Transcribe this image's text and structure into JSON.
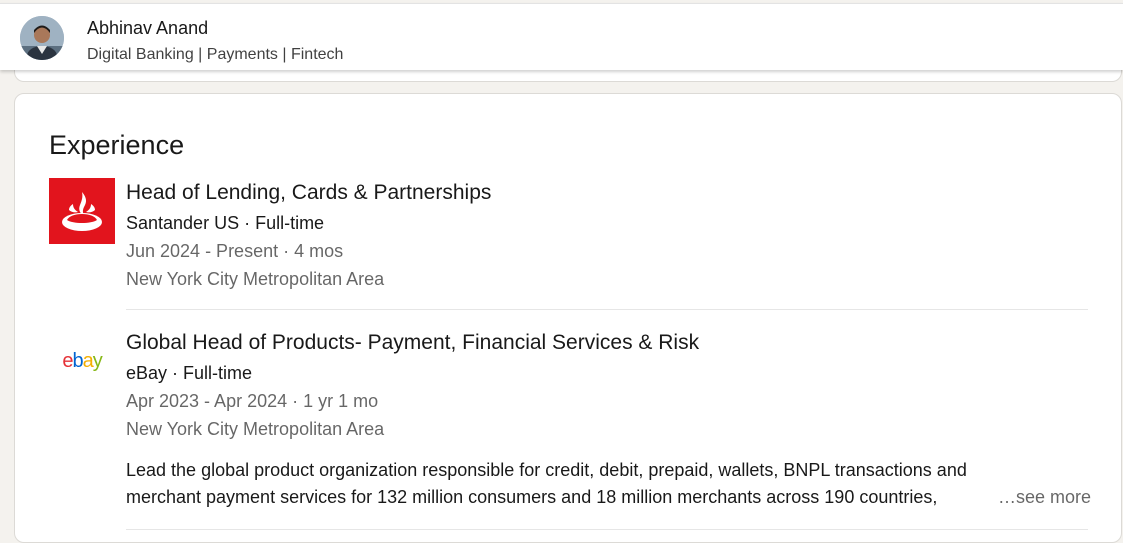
{
  "profile": {
    "name": "Abhinav Anand",
    "headline": "Digital Banking | Payments | Fintech"
  },
  "experience": {
    "title": "Experience",
    "entries": [
      {
        "title": "Head of Lending, Cards & Partnerships",
        "company": "Santander US · Full-time",
        "dates": "Jun 2024 - Present · 4 mos",
        "location": "New York City Metropolitan Area",
        "logo": "santander-flame-logo",
        "logo_color": "#e2141d"
      },
      {
        "title": "Global Head of Products- Payment, Financial Services & Risk",
        "company": "eBay · Full-time",
        "dates": "Apr 2023 - Apr 2024 · 1 yr 1 mo",
        "location": "New York City Metropolitan Area",
        "logo": "ebay-logo",
        "logo_letters": [
          "e",
          "b",
          "a",
          "y"
        ],
        "logo_colors": [
          "#e53238",
          "#0064d2",
          "#f5af02",
          "#86b817"
        ],
        "description_lines": [
          "Lead the global product organization responsible for credit, debit, prepaid, wallets, BNPL transactions and",
          "merchant payment services for 132 million consumers and 18 million merchants across 190 countries,"
        ],
        "see_more": "…see more"
      }
    ]
  }
}
